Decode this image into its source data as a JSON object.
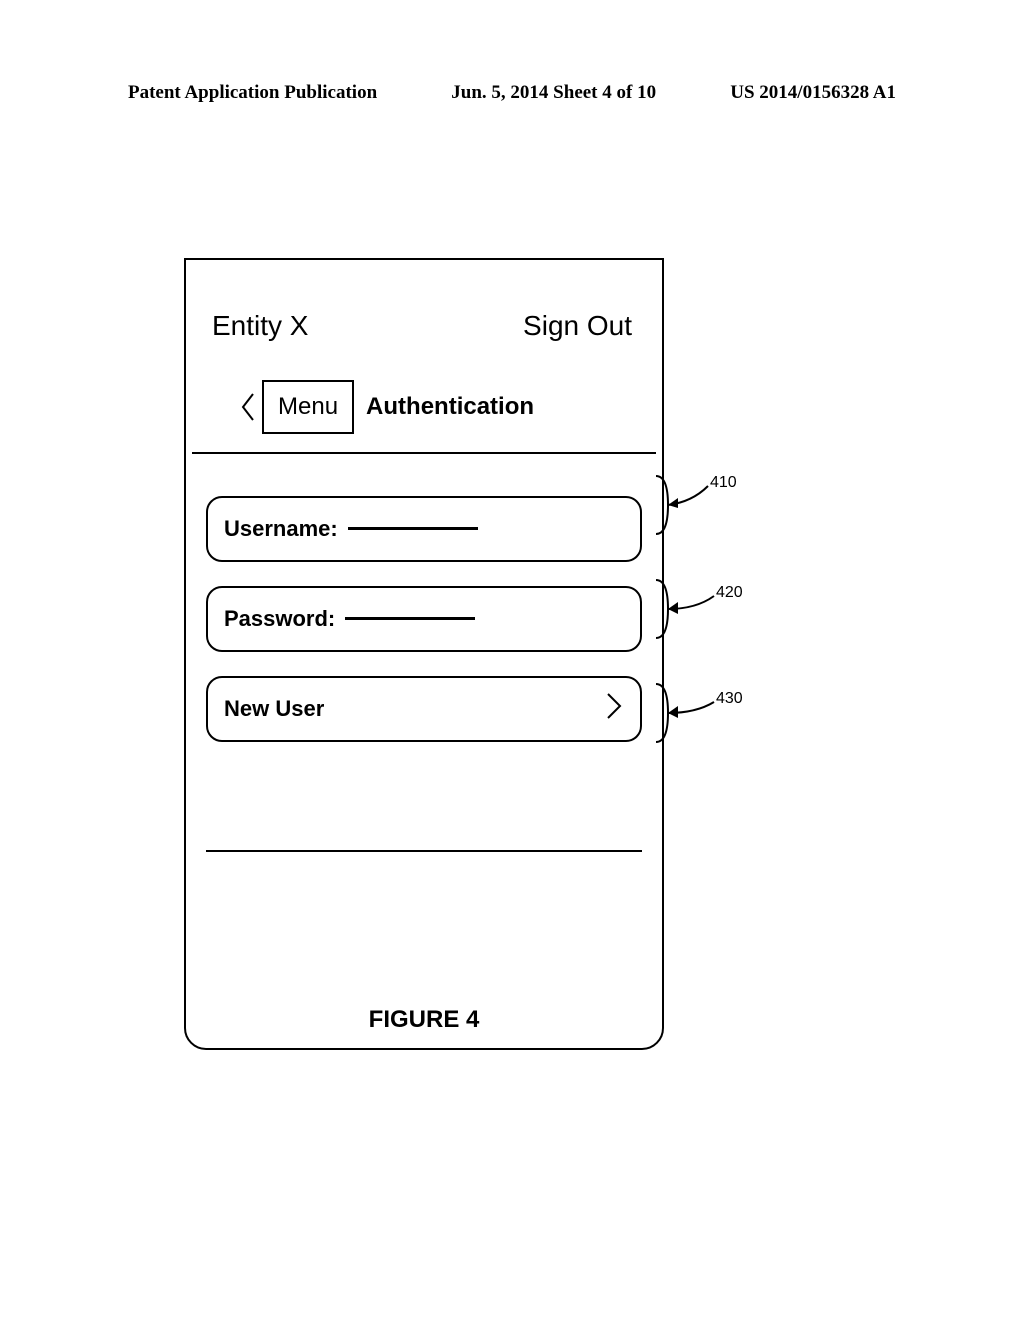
{
  "header": {
    "left": "Patent Application Publication",
    "center": "Jun. 5, 2014  Sheet 4 of 10",
    "right": "US 2014/0156328 A1"
  },
  "screen": {
    "app_title": "Entity X",
    "sign_out": "Sign Out",
    "menu_label": "Menu",
    "page_title": "Authentication",
    "fields": {
      "username_label": "Username:",
      "password_label": "Password:",
      "new_user_label": "New User"
    }
  },
  "callouts": {
    "username": "410",
    "password": "420",
    "new_user": "430"
  },
  "figure_caption": "FIGURE 4"
}
